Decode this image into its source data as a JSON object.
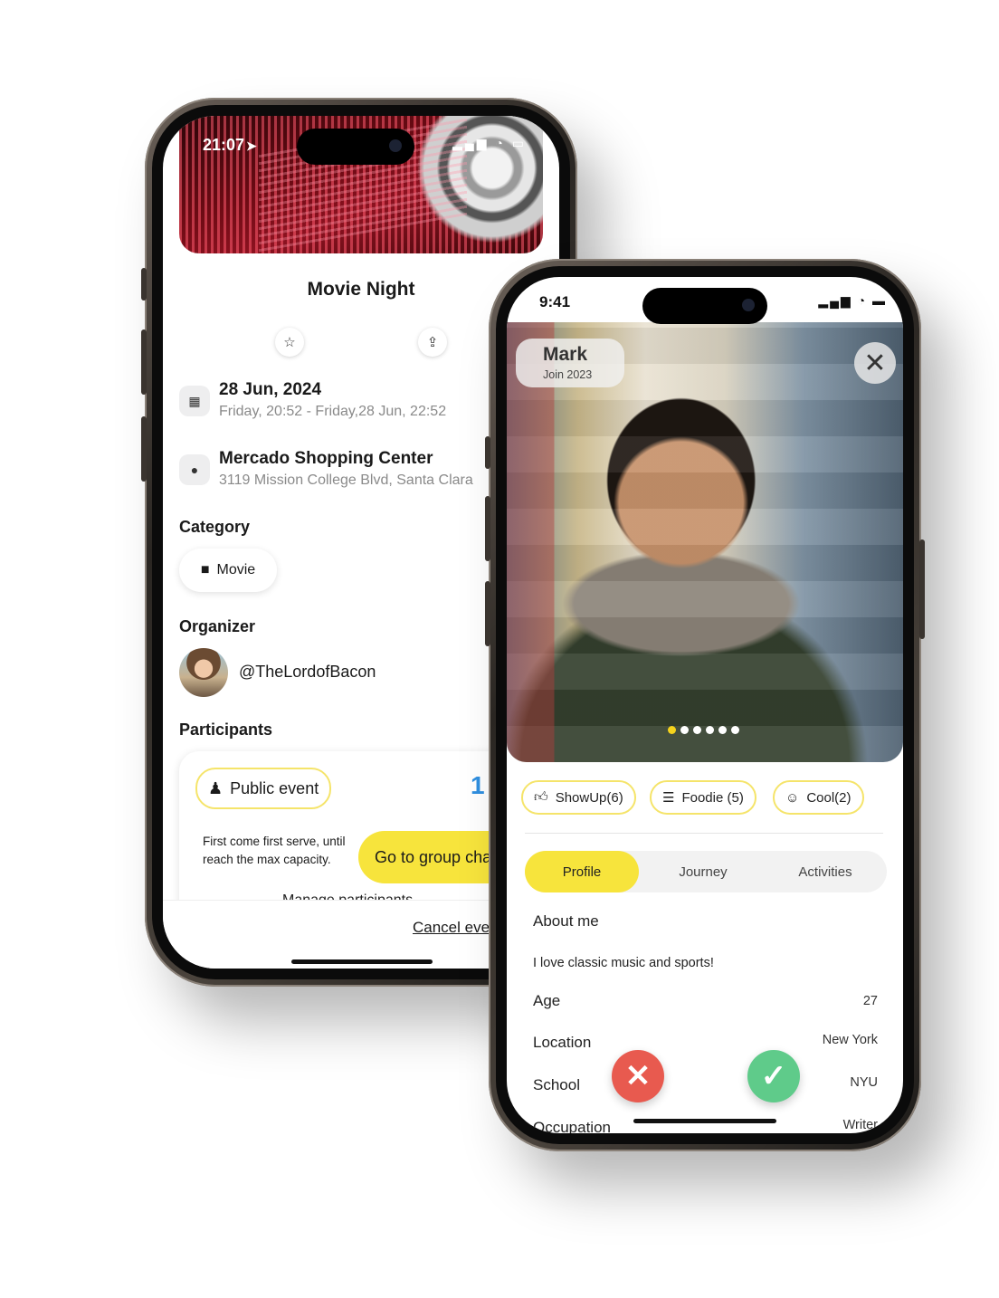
{
  "event_phone": {
    "status_time": "21:07",
    "title": "Movie Night",
    "date_main": "28 Jun, 2024",
    "date_sub": "Friday, 20:52 - Friday,28 Jun, 22:52",
    "location_main": "Mercado Shopping Center",
    "location_sub": "3119 Mission College Blvd, Santa Clara",
    "category_heading": "Category",
    "category_value": "Movie",
    "organizer_heading": "Organizer",
    "organizer_handle": "@TheLordofBacon",
    "participants_heading": "Participants",
    "event_type": "Public event",
    "participant_count": "1",
    "event_desc_line1": "First come first serve, until",
    "event_desc_line2": "reach the max capacity.",
    "manage_label": "Manage participants",
    "group_chat_button": "Go to group chat",
    "cancel_label": "Cancel event"
  },
  "profile_phone": {
    "status_time": "9:41",
    "name": "Mark",
    "joined": "Join 2023",
    "photo_count": 6,
    "active_photo": 1,
    "tags": [
      "ShowUp(6)",
      "Foodie (5)",
      "Cool(2)"
    ],
    "tabs": [
      "Profile",
      "Journey",
      "Activities"
    ],
    "active_tab": "Profile",
    "about_heading": "About me",
    "about_text": "I love classic music and sports!",
    "details": [
      {
        "label": "Age",
        "value": "27"
      },
      {
        "label": "Location",
        "value": "New York"
      },
      {
        "label": "School",
        "value": "NYU"
      },
      {
        "label": "Occupation",
        "value": "Writer"
      }
    ]
  },
  "colors": {
    "accent_yellow": "#f7e43c",
    "reject_red": "#e85a4f",
    "accept_green": "#5fcb8a",
    "count_blue": "#2f8fe0"
  }
}
